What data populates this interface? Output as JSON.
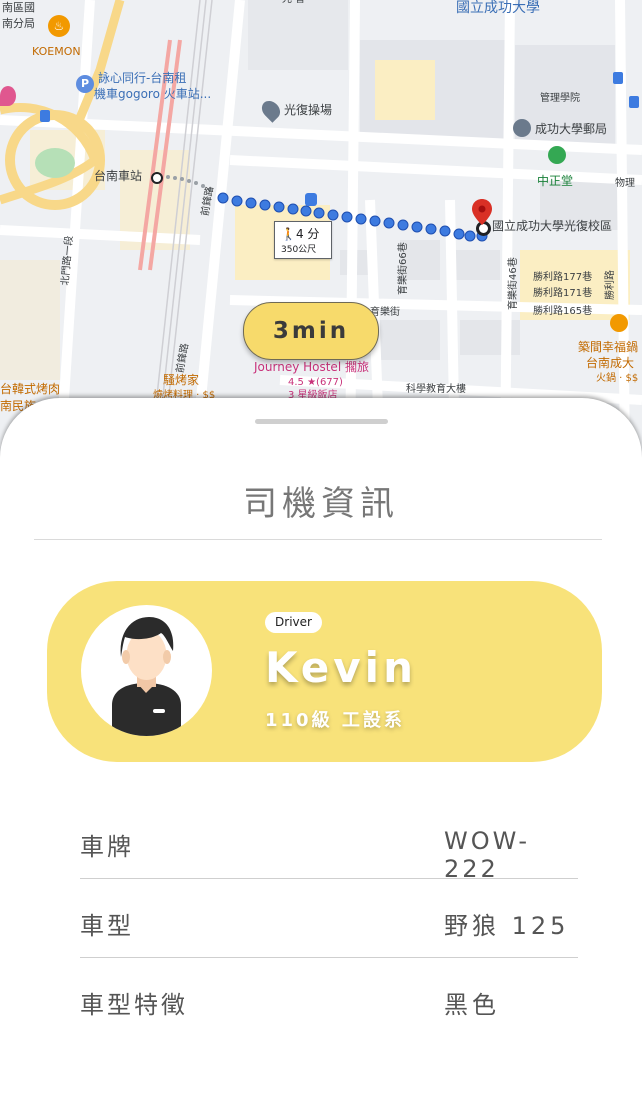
{
  "map": {
    "eta_label": "3min",
    "walk_time": "4 分",
    "walk_distance": "350公尺",
    "labels": {
      "district_top": "南區國",
      "branch": "南分局",
      "koemon": "KOEMON",
      "rental_line1": "詠心同行-台南租",
      "rental_line2": "機車gogoro 火車站...",
      "playground": "光復操場",
      "station": "台南車站",
      "university_title": "國立成功大學",
      "management": "管理學院",
      "post_office": "成功大學郵局",
      "zhongzheng": "中正堂",
      "physics": "物理",
      "campus": "國立成功大學光復校區",
      "road_qianfeng": "前鋒路",
      "road_qianfeng2": "前鋒路",
      "road_beimen": "北門路一段",
      "road_yule": "育樂街66巷",
      "road_yule2": "育樂街46巷",
      "road_yule3": "育樂街",
      "shengli_177": "勝利路177巷",
      "shengli_171": "勝利路171巷",
      "shengli_165": "勝利路165巷",
      "shengli": "勝利路",
      "hostel_name": "Journey Hostel 擱旅",
      "hostel_rating": "4.5 ★(677)",
      "hostel_type": "3 星級飯店",
      "bbq": "騷烤家",
      "bbq_type": "燒烤料理 · $$",
      "korean_bbq": "台韓式烤肉",
      "korean_bbq2": "南民族",
      "happy_restaurant": "築間幸福鍋",
      "happy_restaurant2": "台南成大",
      "happy_restaurant3": "火鍋 · $$",
      "science_building": "科學教育大樓",
      "top_small": "光 智"
    }
  },
  "sheet": {
    "title": "司機資訊",
    "driver": {
      "badge": "Driver",
      "name": "Kevin",
      "subtitle": "110級 工設系"
    },
    "rows": [
      {
        "label": "車牌",
        "value": "WOW-222"
      },
      {
        "label": "車型",
        "value": "野狼 125"
      },
      {
        "label": "車型特徵",
        "value": "黑色"
      }
    ]
  },
  "colors": {
    "accent_yellow": "#f8e27a",
    "eta_yellow": "#f7da6b",
    "route_blue": "#3d7be0",
    "pin_red": "#d93025"
  },
  "icons": [
    "walk-icon",
    "pin-icon",
    "parking-icon",
    "bus-icon",
    "food-icon",
    "hotel-icon",
    "post-icon",
    "landmark-icon"
  ]
}
